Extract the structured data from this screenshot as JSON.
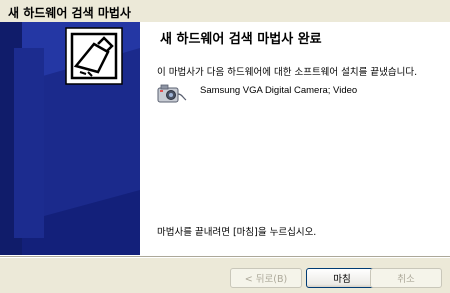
{
  "window": {
    "title": "새 하드웨어 검색 마법사"
  },
  "main": {
    "heading": "새 하드웨어 검색 마법사 완료",
    "description": "이 마법사가 다음 하드웨어에 대한 소프트웨어 설치를 끝냈습니다.",
    "device": {
      "icon": "camera-icon",
      "name": "Samsung VGA Digital Camera; Video"
    },
    "finish_hint": "마법사를 끝내려면 [마침]을 누르십시오."
  },
  "sidebar": {
    "icon": "hardware-wizard-icon",
    "background_color": "#1b2a8c"
  },
  "buttons": {
    "back_label": "< 뒤로(B)",
    "finish_label": "마침",
    "cancel_label": "취소"
  }
}
